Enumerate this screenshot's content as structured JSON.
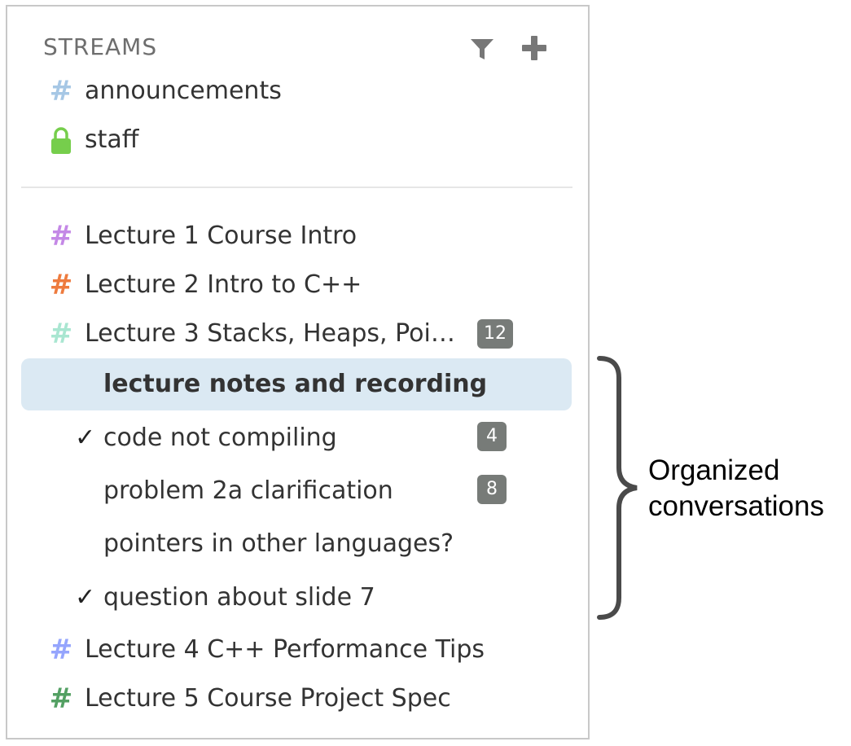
{
  "sidebar": {
    "header": {
      "title": "STREAMS",
      "filter_icon": "filter-icon",
      "add_icon": "plus-icon"
    },
    "pinned_streams": [
      {
        "name": "announcements",
        "icon": "hash-icon",
        "color": "#a6c7e5"
      },
      {
        "name": "staff",
        "icon": "lock-icon",
        "color": "#76ce4c"
      }
    ],
    "streams": [
      {
        "name": "Lecture 1 Course Intro",
        "color": "#c488e6"
      },
      {
        "name": "Lecture 2 Intro to C++",
        "color": "#ee7b3e"
      },
      {
        "name": "Lecture 3 Stacks, Heaps, Poi…",
        "color": "#a9e6d1",
        "unread": "12"
      },
      {
        "name": "Lecture 4 C++ Performance Tips",
        "color": "#95a5fd"
      },
      {
        "name": "Lecture 5 Course Project Spec",
        "color": "#53a063"
      }
    ],
    "topics": [
      {
        "name": "lecture notes and recording",
        "active": true
      },
      {
        "name": "code not compiling",
        "resolved": "✓",
        "unread": "4"
      },
      {
        "name": "problem 2a clarification",
        "unread": "8"
      },
      {
        "name": "pointers in other languages?"
      },
      {
        "name": "question about slide 7",
        "resolved": "✓"
      }
    ]
  },
  "annotation": {
    "line1": "Organized",
    "line2": "conversations"
  },
  "colors": {
    "active_topic_bg": "#dbe9f3",
    "badge_bg": "#777b78",
    "header_text": "#6e6e6e",
    "bracket": "#4a4a4a"
  }
}
